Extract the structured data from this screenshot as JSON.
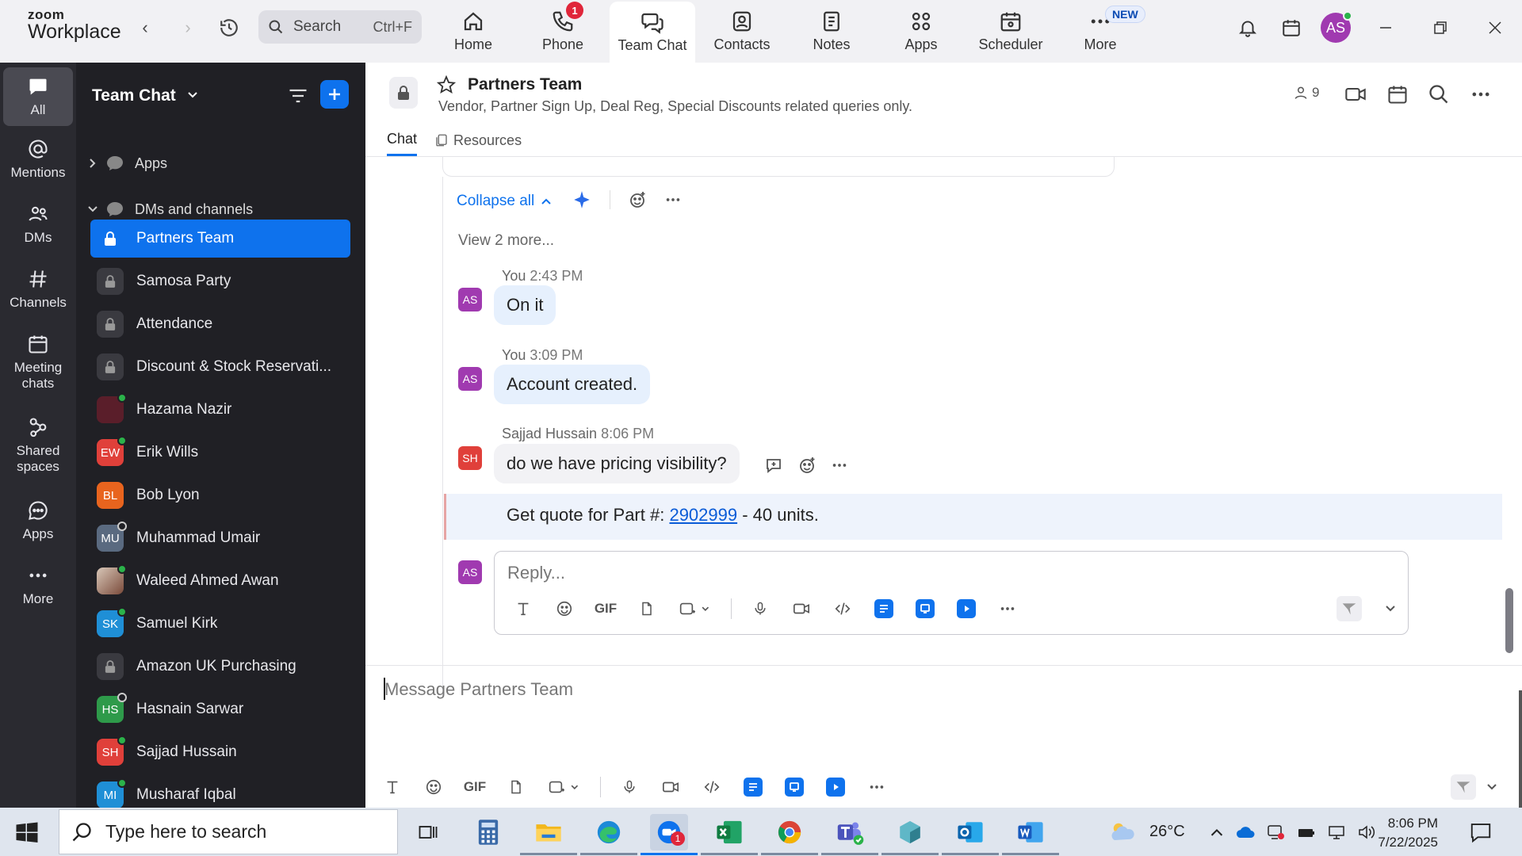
{
  "brand": {
    "line1": "zoom",
    "line2": "Workplace"
  },
  "search": {
    "label": "Search",
    "shortcut": "Ctrl+F"
  },
  "tabs": [
    {
      "label": "Home"
    },
    {
      "label": "Phone",
      "badge": "1"
    },
    {
      "label": "Team Chat"
    },
    {
      "label": "Contacts"
    },
    {
      "label": "Notes"
    },
    {
      "label": "Apps"
    },
    {
      "label": "Scheduler"
    },
    {
      "label": "More",
      "badge": "NEW"
    }
  ],
  "user": {
    "initials": "AS"
  },
  "rail": [
    {
      "label": "All"
    },
    {
      "label": "Mentions"
    },
    {
      "label": "DMs"
    },
    {
      "label": "Channels"
    },
    {
      "label": "Meeting chats"
    },
    {
      "label": "Shared spaces"
    },
    {
      "label": "Apps"
    },
    {
      "label": "More"
    }
  ],
  "sidebar": {
    "title": "Team Chat",
    "sections": [
      {
        "label": "Apps"
      },
      {
        "label": "DMs and channels"
      }
    ],
    "items": [
      {
        "label": "Partners Team",
        "initials": "",
        "color": "#0e72ed"
      },
      {
        "label": "Samosa Party",
        "initials": "",
        "color": "#3a3a40"
      },
      {
        "label": "Attendance",
        "initials": "",
        "color": "#3a3a40"
      },
      {
        "label": "Discount & Stock Reservati...",
        "initials": "",
        "color": "#3a3a40"
      },
      {
        "label": "Hazama Nazir",
        "initials": "",
        "color": "#5a1e2a"
      },
      {
        "label": "Erik Wills",
        "initials": "EW",
        "color": "#e0403a"
      },
      {
        "label": "Bob Lyon",
        "initials": "BL",
        "color": "#e8641e"
      },
      {
        "label": "Muhammad Umair",
        "initials": "MU",
        "color": "#5a6a80"
      },
      {
        "label": "Waleed Ahmed Awan",
        "initials": "",
        "color": "#7a4a3a"
      },
      {
        "label": "Samuel Kirk",
        "initials": "SK",
        "color": "#1f8fd6"
      },
      {
        "label": "Amazon UK Purchasing",
        "initials": "",
        "color": "#3a3a40"
      },
      {
        "label": "Hasnain Sarwar",
        "initials": "HS",
        "color": "#2e9a4a"
      },
      {
        "label": "Sajjad Hussain",
        "initials": "SH",
        "color": "#e0403a"
      },
      {
        "label": "Musharaf Iqbal",
        "initials": "MI",
        "color": "#1f8fd6"
      }
    ]
  },
  "channel": {
    "title": "Partners Team",
    "description": "Vendor, Partner Sign Up, Deal Reg, Special Discounts related queries only.",
    "members": "9",
    "tabs": [
      "Chat",
      "Resources"
    ]
  },
  "thread": {
    "collapse_label": "Collapse all",
    "view_more": "View 2 more...",
    "messages": [
      {
        "initials": "AS",
        "sender": "You",
        "time": "2:43 PM",
        "text": "On it",
        "color": "#a03ab0"
      },
      {
        "initials": "AS",
        "sender": "You",
        "time": "3:09 PM",
        "text": "Account created.",
        "color": "#a03ab0"
      },
      {
        "initials": "SH",
        "sender": "Sajjad Hussain",
        "time": "8:06 PM",
        "text": "do we have pricing visibility?",
        "color": "#e0403a"
      }
    ],
    "highlight": {
      "prefix": "Get quote for Part #: ",
      "link": "2902999",
      "suffix": " - 40 units."
    },
    "reply_initials": "AS",
    "reply_placeholder": "Reply..."
  },
  "composer": {
    "placeholder": "Message Partners Team",
    "gif_label": "GIF"
  },
  "taskbar": {
    "search_placeholder": "Type here to search",
    "weather": "26°C",
    "time": "8:06 PM",
    "date": "7/22/2025",
    "zoom_badge": "1"
  }
}
